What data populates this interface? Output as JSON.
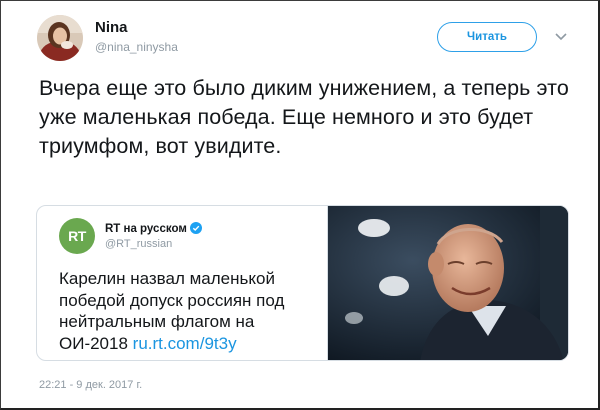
{
  "user": {
    "name": "Nina",
    "handle": "@nina_ninysha",
    "follow_label": "Читать"
  },
  "tweet": {
    "text": "Вчера еще это было диким унижением, а теперь это уже маленькая победа. Еще немного и это будет триумфом, вот увидите.",
    "timestamp": "22:21 - 9 дек. 2017 г."
  },
  "quoted": {
    "logo_text": "RT",
    "name": "RT на русском",
    "handle": "@RT_russian",
    "text": "Карелин назвал маленькой победой допуск россиян под нейтральным флагом на ОИ-2018 ",
    "link": "ru.rt.com/9t3y"
  },
  "colors": {
    "accent": "#1b95e0",
    "rt_green": "#6aa84f",
    "secondary_text": "#8f9aa3"
  },
  "icons": {
    "menu": "chevron-down-icon",
    "verified": "verified-badge-icon"
  }
}
